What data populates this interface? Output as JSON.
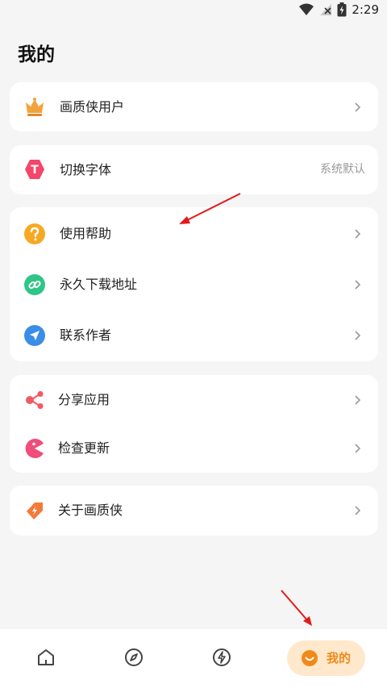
{
  "status_bar": {
    "time": "2:29"
  },
  "page": {
    "title": "我的"
  },
  "cards": {
    "vip": {
      "label": "画质侠用户"
    },
    "font": {
      "label": "切换字体",
      "value": "系统默认"
    },
    "help": [
      {
        "label": "使用帮助"
      },
      {
        "label": "永久下载地址"
      },
      {
        "label": "联系作者"
      }
    ],
    "share": [
      {
        "label": "分享应用"
      },
      {
        "label": "检查更新"
      }
    ],
    "about": {
      "label": "关于画质侠"
    }
  },
  "bottom_nav": {
    "items": [
      {
        "icon": "home-icon"
      },
      {
        "icon": "compass-icon"
      },
      {
        "icon": "lightning-icon"
      }
    ],
    "active": {
      "icon": "smile-icon",
      "label": "我的"
    }
  },
  "colors": {
    "accent": "#f08a1a",
    "accent_bg": "#ffe8cc",
    "annotation": "#e11a1a"
  }
}
